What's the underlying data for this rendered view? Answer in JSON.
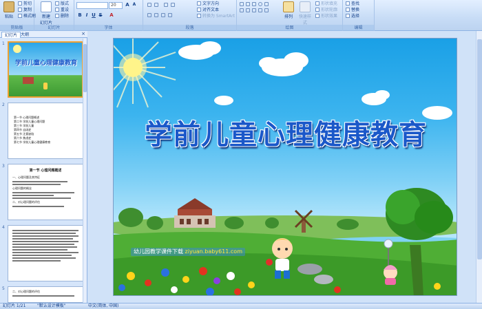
{
  "ribbon": {
    "clipboard": {
      "paste": "粘贴",
      "cut": "剪切",
      "copy": "复制",
      "format_painter": "格式刷",
      "group": "剪贴板"
    },
    "slides": {
      "new_slide": "新建",
      "new_slide_2": "幻灯片",
      "layout": "版式",
      "reset": "重设",
      "delete": "删除",
      "group": "幻灯片"
    },
    "font": {
      "font_name": "",
      "font_size": "20",
      "group": "字体"
    },
    "paragraph": {
      "text_direction": "文字方向",
      "align_text": "对齐文本",
      "smartart": "转换为 SmartArt",
      "group": "段落"
    },
    "drawing": {
      "arrange": "排列",
      "quick_styles": "快速样式",
      "shape_fill": "形状填充",
      "shape_outline": "形状轮廓",
      "shape_effects": "形状效果",
      "group": "绘图"
    },
    "editing": {
      "find": "查找",
      "replace": "替换",
      "select": "选择",
      "group": "编辑"
    }
  },
  "panel": {
    "tab_slides": "幻灯片",
    "tab_outline": "大纲",
    "close": "×",
    "slide_numbers": [
      "1",
      "2",
      "3",
      "4",
      "5"
    ],
    "thumb1_title": "学前儿童心理健康教育",
    "thumb2_lines": [
      "第一节 心理问题概述",
      "第二节 学前儿童心理问题",
      "第三节 学前儿童",
      "第四节 自闭症",
      "第五节 注意缺陷",
      "第六节 焦虑症",
      "第七节 学前儿童心理健康教育"
    ],
    "thumb3_title": "第一节 心理问题概述",
    "thumb3_lines": [
      "一、心理问题及其特征",
      "心理问题的概念",
      "二、对心理问题的评估"
    ],
    "thumb5_line": "二、对心理问题的评估"
  },
  "slide": {
    "title": "学前儿童心理健康教育",
    "site_prefix": "幼儿园教学课件下载",
    "site_url": "ziyuan.baby611.com"
  },
  "status": {
    "slide_pos": "幻灯片 1/21",
    "theme": "\"默认设计模板\"",
    "language": "中文(简体, 中国)"
  },
  "colors": {
    "ribbon_bg": "#c7dcf6",
    "title_blue": "#1b58c9",
    "selected_thumb": "#f0a030"
  }
}
